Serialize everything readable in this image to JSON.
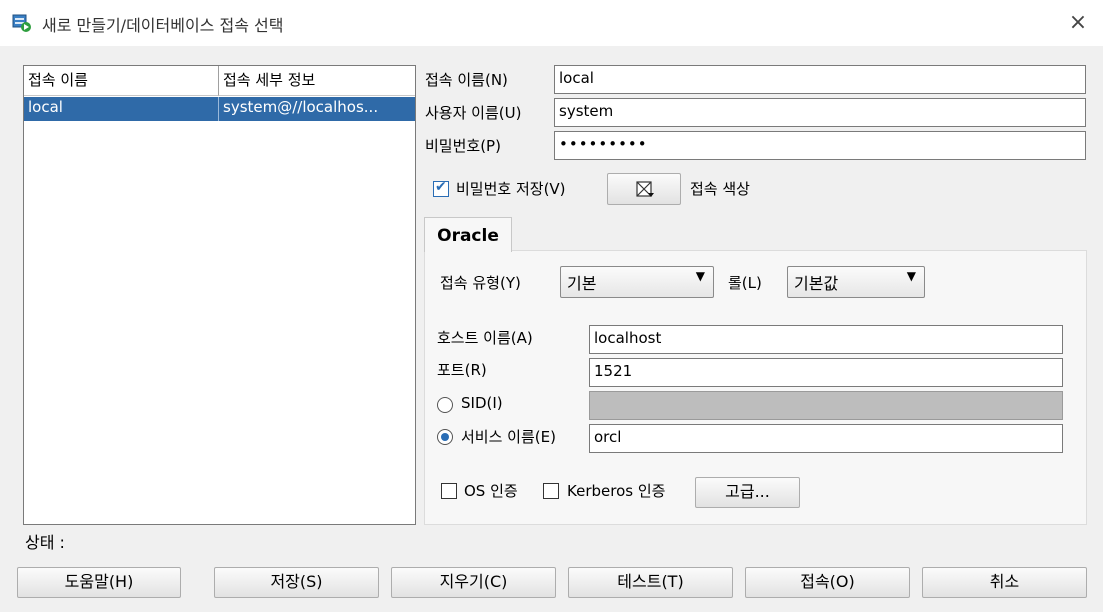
{
  "window": {
    "title": "새로 만들기/데이터베이스 접속 선택",
    "close_icon": "×"
  },
  "connections": {
    "columns": [
      "접속 이름",
      "접속 세부 정보"
    ],
    "rows": [
      {
        "name": "local",
        "details": "system@//localhos..."
      }
    ]
  },
  "form": {
    "conn_name_label": "접속 이름(N)",
    "conn_name_value": "local",
    "user_label": "사용자 이름(U)",
    "user_value": "system",
    "password_label": "비밀번호(P)",
    "password_value": "•••••••••",
    "save_password_label": "비밀번호 저장(V)",
    "save_password_checked": true,
    "conn_color_label": "접속 색상"
  },
  "oracle_tab": {
    "tab_label": "Oracle",
    "conn_type_label": "접속 유형(Y)",
    "conn_type_value": "기본",
    "role_label": "롤(L)",
    "role_value": "기본값",
    "host_label": "호스트 이름(A)",
    "host_value": "localhost",
    "port_label": "포트(R)",
    "port_value": "1521",
    "sid_label": "SID(I)",
    "sid_value": "",
    "service_label": "서비스 이름(E)",
    "service_value": "orcl",
    "selected_option": "service",
    "os_auth_label": "OS 인증",
    "kerberos_label": "Kerberos 인증",
    "advanced_label": "고급..."
  },
  "status": {
    "label": "상태 :"
  },
  "buttons": {
    "help": "도움말(H)",
    "save": "저장(S)",
    "clear": "지우기(C)",
    "test": "테스트(T)",
    "connect": "접속(O)",
    "cancel": "취소"
  },
  "colors": {
    "selection": "#2f6aa8",
    "radio_accent": "#2a6db5"
  }
}
